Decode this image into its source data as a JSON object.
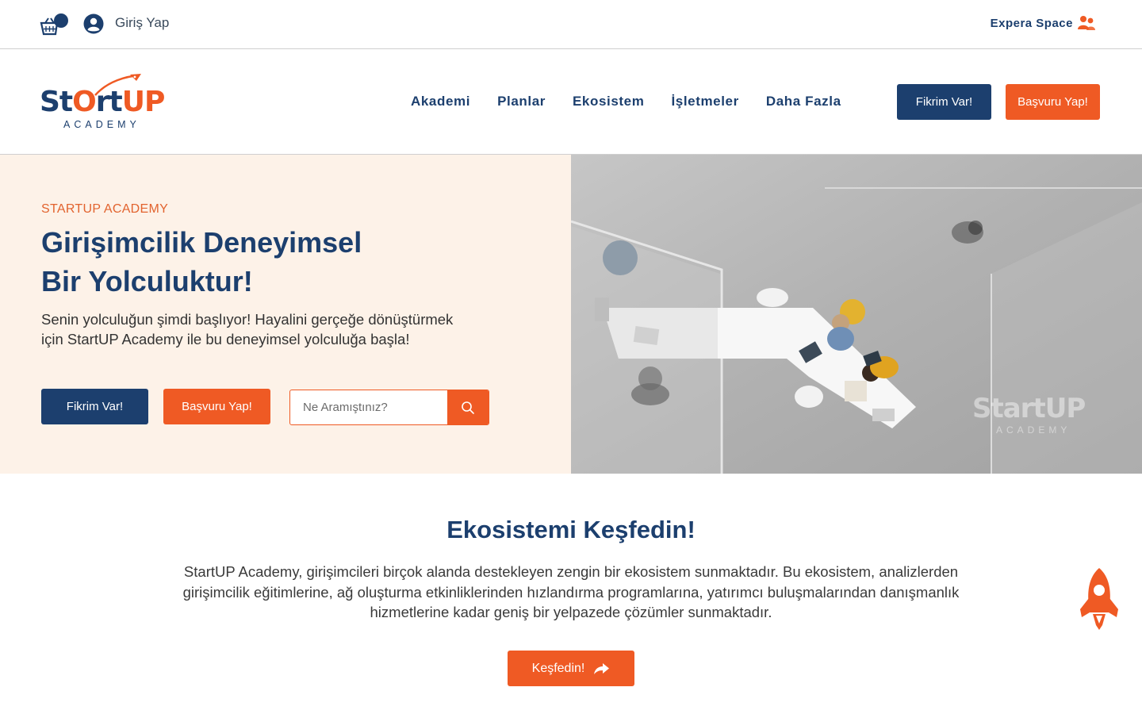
{
  "topbar": {
    "login_label": "Giriş Yap",
    "expera_label": "Expera Space"
  },
  "nav": {
    "logo_word_start": "St",
    "logo_word_o": "O",
    "logo_word_rt": "rt",
    "logo_word_up": "UP",
    "logo_sub": "ACADEMY",
    "items": [
      {
        "label": "Akademi"
      },
      {
        "label": "Planlar"
      },
      {
        "label": "Ekosistem"
      },
      {
        "label": "İşletmeler"
      },
      {
        "label": "Daha Fazla"
      }
    ],
    "idea_button": "Fikrim Var!",
    "apply_button": "Başvuru Yap!"
  },
  "hero": {
    "eyebrow": "STARTUP ACADEMY",
    "title_line1": "Girişimcilik Deneyimsel",
    "title_line2": "Bir Yolculuktur!",
    "description": "Senin yolculuğun şimdi başlıyor! Hayalini gerçeğe dönüştürmek için StartUP Academy ile bu deneyimsel yolculuğa başla!",
    "idea_button": "Fikrim Var!",
    "apply_button": "Başvuru Yap!",
    "search_placeholder": "Ne Aramıştınız?",
    "image_watermark": "StartUP",
    "image_watermark_sub": "ACADEMY"
  },
  "ecosystem": {
    "title": "Ekosistemi Keşfedin!",
    "description": "StartUP Academy, girişimcileri birçok alanda destekleyen zengin bir ekosistem sunmaktadır. Bu ekosistem, analizlerden girişimcilik eğitimlerine, ağ oluşturma etkinliklerinden hızlandırma programlarına, yatırımcı buluşmalarından danışmanlık hizmetlerine kadar geniş bir yelpazede çözümler sunmaktadır.",
    "button_label": "Keşfedin!"
  },
  "colors": {
    "navy": "#1c3f6e",
    "orange": "#ef5a24",
    "hero_bg": "#fdf2e8"
  },
  "icons": [
    "cart-icon",
    "user-icon",
    "expera-space-icon",
    "rocket-logo-icon",
    "search-icon",
    "share-arrow-icon",
    "floating-rocket-icon"
  ]
}
